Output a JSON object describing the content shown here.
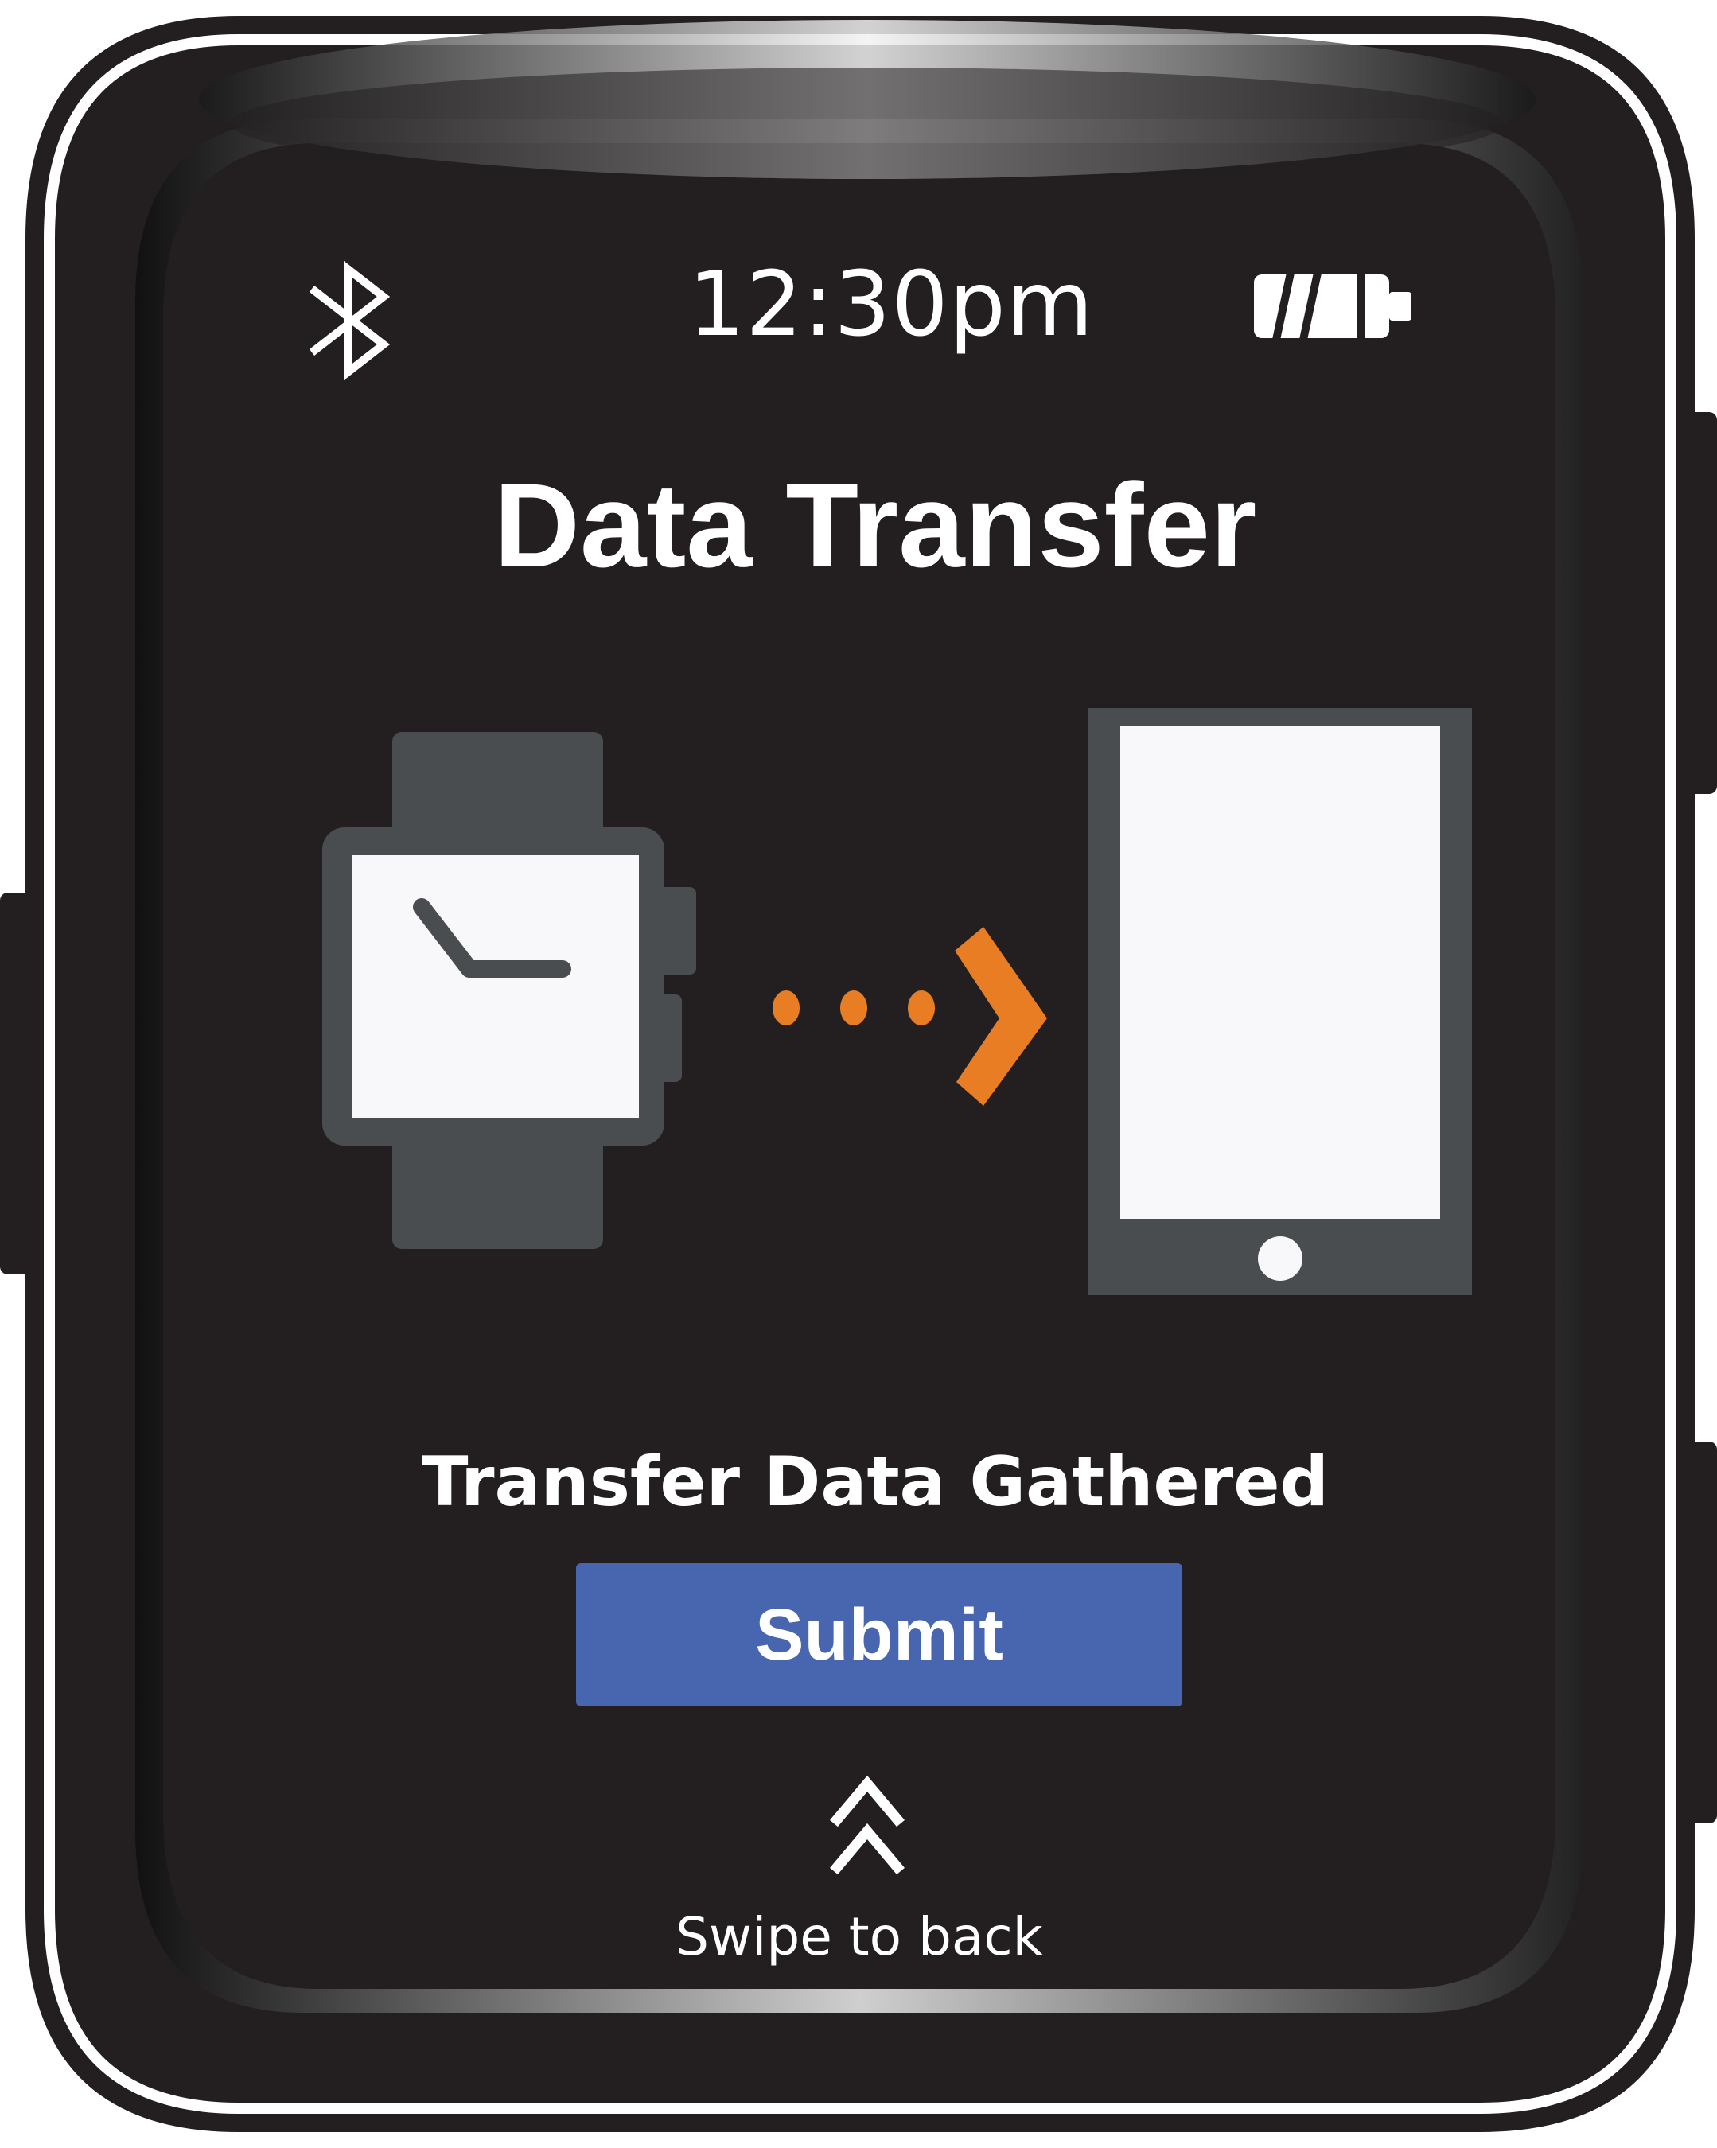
{
  "status_bar": {
    "time": "12:30pm",
    "bluetooth_icon": "bluetooth-icon",
    "battery_icon": "battery-icon",
    "battery_level": 0.66
  },
  "screen": {
    "title": "Data Transfer",
    "illustration": {
      "source_icon": "smartwatch-icon",
      "transfer_icon": "transfer-arrow-icon",
      "target_icon": "smartphone-icon"
    },
    "message": "Transfer Data Gathered",
    "submit_label": "Submit",
    "swipe_icon": "double-chevron-up-icon",
    "swipe_label": "Swipe to back"
  },
  "colors": {
    "screen_background": "#231f20",
    "accent_orange": "#e87d23",
    "button_blue": "#4865b0",
    "icon_gray": "#4a4d50",
    "text_white": "#ffffff"
  }
}
